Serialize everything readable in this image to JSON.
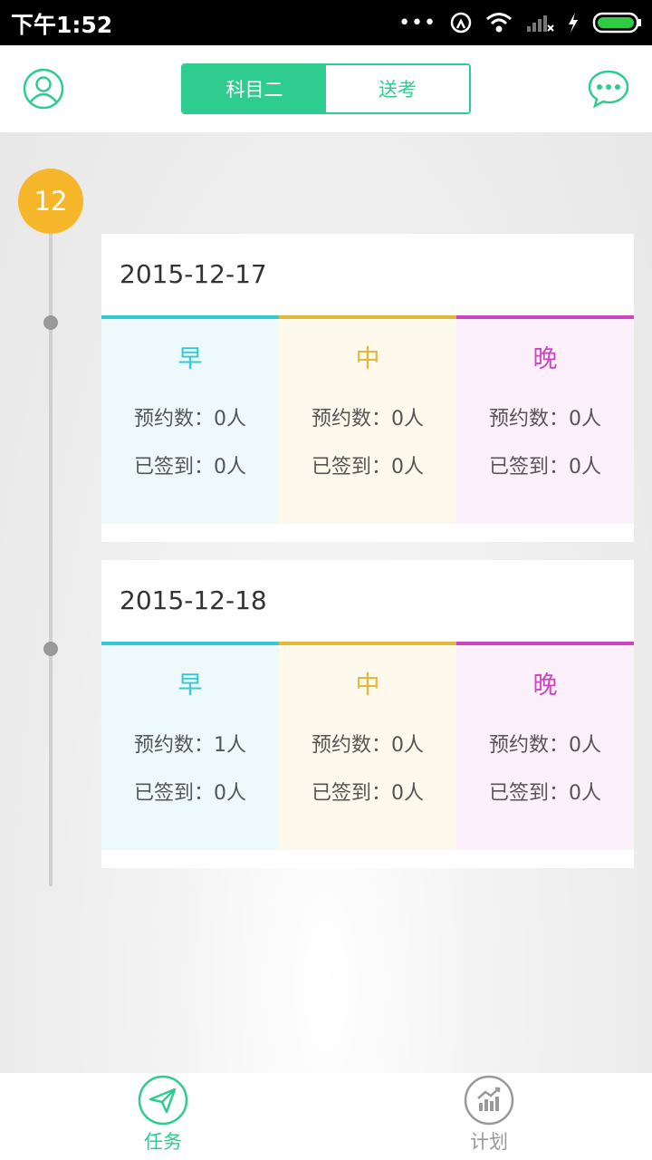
{
  "status_bar": {
    "time": "下午1:52"
  },
  "header": {
    "tabs": [
      {
        "label": "科目二",
        "active": true
      },
      {
        "label": "送考",
        "active": false
      }
    ],
    "accent_color": "#2ecc8f"
  },
  "timeline": {
    "month": "12",
    "days": [
      {
        "date": "2015-12-17",
        "slots": [
          {
            "label": "早",
            "booked": "预约数：0人",
            "checked_in": "已签到：0人"
          },
          {
            "label": "中",
            "booked": "预约数：0人",
            "checked_in": "已签到：0人"
          },
          {
            "label": "晚",
            "booked": "预约数：0人",
            "checked_in": "已签到：0人"
          }
        ]
      },
      {
        "date": "2015-12-18",
        "slots": [
          {
            "label": "早",
            "booked": "预约数：1人",
            "checked_in": "已签到：0人"
          },
          {
            "label": "中",
            "booked": "预约数：0人",
            "checked_in": "已签到：0人"
          },
          {
            "label": "晚",
            "booked": "预约数：0人",
            "checked_in": "已签到：0人"
          }
        ]
      }
    ]
  },
  "bottom_nav": {
    "items": [
      {
        "label": "任务",
        "icon": "paper-plane-icon",
        "active": true
      },
      {
        "label": "计划",
        "icon": "chart-icon",
        "active": false
      }
    ]
  }
}
